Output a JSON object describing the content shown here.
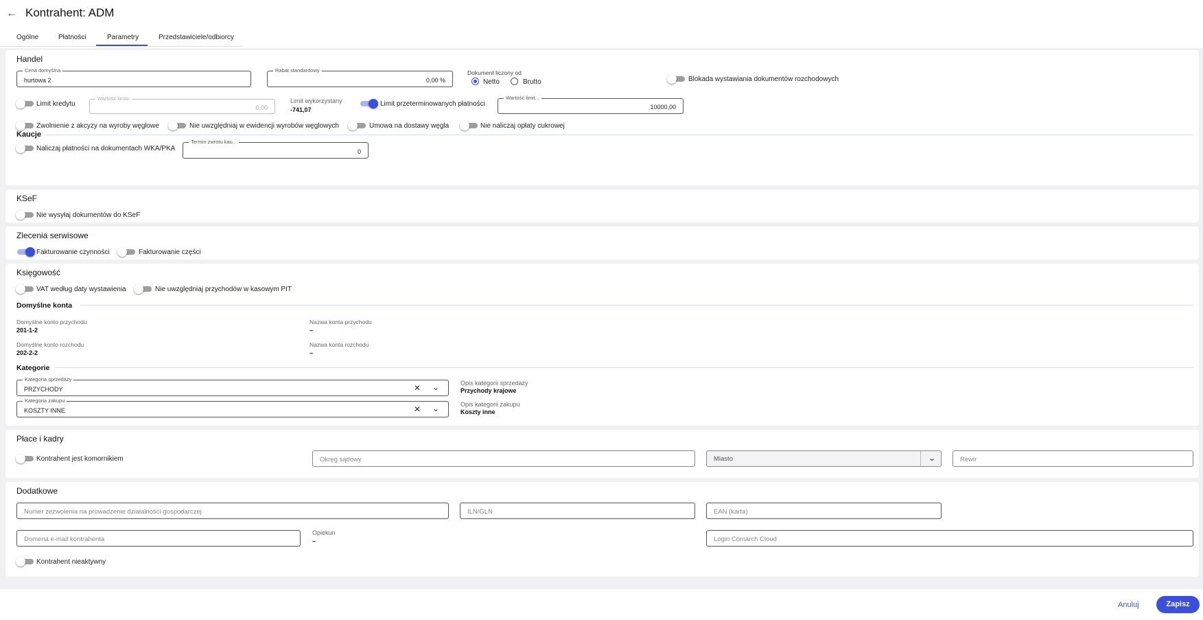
{
  "header": {
    "title": "Kontrahent: ADM"
  },
  "tabs": [
    "Ogólne",
    "Płatności",
    "Parametry",
    "Przedstawiciele/odbiorcy"
  ],
  "handel": {
    "title": "Handel",
    "cena_label": "Cena domyślna",
    "cena_value": "hurtowa 2",
    "rabat_label": "Rabat standardowy",
    "rabat_value": "0,00 %",
    "dok_label": "Dokument liczony od",
    "netto": "Netto",
    "brutto": "Brutto",
    "selected": "Netto",
    "blokada": "Blokada wystawiania dokumentów rozchodowych",
    "limit_kredytu": "Limit kredytu",
    "wartosc_limitu_label": "Wartość limitu",
    "wartosc_limitu_value": "0,00",
    "limit_wyk_label": "Limit wykorzystany",
    "limit_wyk_value": "-741,07",
    "limit_przeter": "Limit przeterminowanych płatności",
    "wartosc_limitu2_label": "Wartość limit...",
    "wartosc_limitu2_value": "10000,00",
    "akcyza": "Zwolnienie z akcyzy na wyroby węglowe",
    "nie_uwzgl": "Nie uwzględniaj w ewidencji wyrobów węglowych",
    "umowa": "Umowa na dostawy węgla",
    "cukrowa": "Nie naliczaj opłaty cukrowej",
    "kaucje_title": "Kaucje",
    "kaucje_toggle": "Naliczaj płatności na dokumentach WKA/PKA",
    "termin_label": "Termin zwrotu kau...",
    "termin_value": "0"
  },
  "ksef": {
    "title": "KSeF",
    "toggle": "Nie wysyłaj dokumentów do KSeF"
  },
  "zlecenia": {
    "title": "Zlecenia serwisowe",
    "czynnosci": "Fakturowanie czynności",
    "czesci": "Fakturowanie części"
  },
  "ksiegowosc": {
    "title": "Księgowość",
    "vat": "VAT według daty wystawienia",
    "pit": "Nie uwzględniaj przychodów w kasowym PIT",
    "konta_title": "Domyślne konta",
    "konto_przych_label": "Domyślne konto przychodu",
    "konto_przych_value": "201-1-2",
    "nazwa_przych_label": "Nazwa konta przychodu",
    "nazwa_przych_value": "–",
    "konto_rozch_label": "Domyślne konto rozchodu",
    "konto_rozch_value": "202-2-2",
    "nazwa_rozch_label": "Nazwa konta rozchodu",
    "nazwa_rozch_value": "–",
    "kategorie_title": "Kategorie",
    "kat_sprz_label": "Kategoria sprzedaży",
    "kat_sprz_value": "PRZYCHODY",
    "opis_sprz_label": "Opis kategorii sprzedaży",
    "opis_sprz_value": "Przychody krajowe",
    "kat_zak_label": "Kategoria zakupu",
    "kat_zak_value": "KOSZTY INNE",
    "opis_zak_label": "Opis kategorii zakupu",
    "opis_zak_value": "Koszty inne"
  },
  "place": {
    "title": "Płace i kadry",
    "komornik": "Kontrahent jest komornikiem",
    "okreg_ph": "Okręg sądowy",
    "miasto_ph": "Miasto",
    "rewir_ph": "Rewir"
  },
  "dodatkowe": {
    "title": "Dodatkowe",
    "zezwolenie_ph": "Numer zezwolenia na prowadzenie działalności gospodarczej",
    "iln_ph": "ILN/GLN",
    "ean_ph": "EAN (karta)",
    "domena_ph": "Domena e-mail kontrahenta",
    "opiekun_label": "Opiekun",
    "opiekun_value": "–",
    "login_ph": "Login Comarch Cloud",
    "nieaktywny": "Kontrahent nieaktywny"
  },
  "footer": {
    "cancel": "Anuluj",
    "save": "Zapisz"
  },
  "colors": {
    "accent": "#3b4fd8",
    "toggle_off": "#9e9e9e",
    "background": "#f1f1f3"
  },
  "icons": {
    "back": "arrow-left-icon",
    "clear": "close-icon",
    "dropdown": "chevron-down-icon"
  }
}
